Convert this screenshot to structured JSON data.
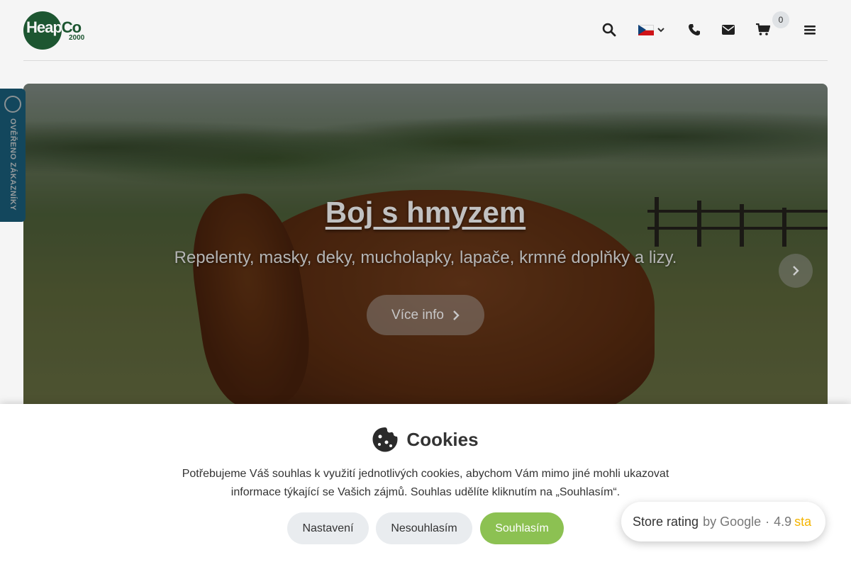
{
  "header": {
    "logo_text_a": "Heap",
    "logo_text_b": "Co",
    "logo_sub": "2000",
    "icons": {
      "search": "search-icon",
      "flag": "czech-flag-icon",
      "phone": "phone-icon",
      "mail": "envelope-icon",
      "cart": "cart-icon",
      "menu": "hamburger-menu-icon"
    },
    "cart_count": "0"
  },
  "verified_badge": {
    "label": "OVĚŘENO ZÁKAZNÍKY"
  },
  "hero": {
    "title": "Boj s hmyzem",
    "subtitle": "Repelenty, masky, deky, mucholapky, lapače, krmné doplňky a lizy.",
    "button_label": "Více info"
  },
  "cookies": {
    "title": "Cookies",
    "text": "Potřebujeme Váš souhlas k využití jednotlivých cookies, abychom Vám mimo jiné mohli ukazovat informace týkající se Vašich zájmů. Souhlas udělíte kliknutím na „Souhlasím“.",
    "btn_settings": "Nastavení",
    "btn_decline": "Nesouhlasím",
    "btn_accept": "Souhlasím",
    "accent_color": "#8cc152"
  },
  "rating": {
    "label": "Store rating",
    "provider": "by Google",
    "separator": "·",
    "score": "4.9",
    "stars_text": "sta"
  }
}
